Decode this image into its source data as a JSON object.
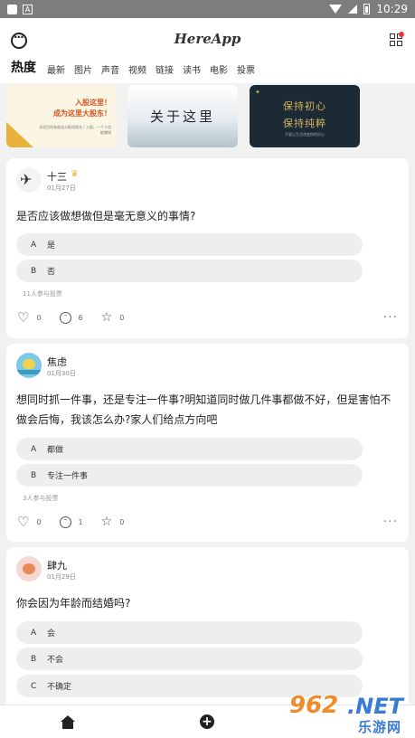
{
  "status_bar": {
    "time": "10:29"
  },
  "header": {
    "app_title": "HereApp",
    "tabs": [
      {
        "label": "热度",
        "active": true
      },
      {
        "label": "最新"
      },
      {
        "label": "图片"
      },
      {
        "label": "声音"
      },
      {
        "label": "视频"
      },
      {
        "label": "链接"
      },
      {
        "label": "读书"
      },
      {
        "label": "电影"
      },
      {
        "label": "投票"
      }
    ]
  },
  "banners": [
    {
      "line1": "入股这里！",
      "line2": "成为这里大股东！",
      "small": "本项目所有收益分配给股东 / 入股、一个人也能赚钱"
    },
    {
      "text": "关于这里"
    },
    {
      "line1": "保持初心",
      "line2": "保持纯粹",
      "small": "不要让生活改变你的初心"
    }
  ],
  "posts": [
    {
      "user": "十三",
      "date": "01月27日",
      "question": "是否应该做想做但是毫无意义的事情?",
      "options": [
        {
          "letter": "A",
          "text": "是"
        },
        {
          "letter": "B",
          "text": "否"
        }
      ],
      "votes": "11人参与投票",
      "likes": "0",
      "comments": "6",
      "favorites": "0"
    },
    {
      "user": "焦虑",
      "date": "01月30日",
      "question": "想同时抓一件事，还是专注一件事?明知道同时做几件事都做不好，但是害怕不做会后悔，我该怎么办?家人们给点方向吧",
      "options": [
        {
          "letter": "A",
          "text": "都做"
        },
        {
          "letter": "B",
          "text": "专注一件事"
        }
      ],
      "votes": "3人参与投票",
      "likes": "0",
      "comments": "1",
      "favorites": "0"
    },
    {
      "user": "肆九",
      "date": "01月29日",
      "question": "你会因为年龄而结婚吗?",
      "options": [
        {
          "letter": "A",
          "text": "会"
        },
        {
          "letter": "B",
          "text": "不会"
        },
        {
          "letter": "C",
          "text": "不确定"
        }
      ]
    }
  ],
  "watermark": {
    "num": "962",
    "dot": ".NET",
    "sub": "乐游网"
  },
  "colors": {
    "accent_crown": "#f2b83b",
    "background": "#f1f1f1",
    "notification_dot": "#e53935"
  }
}
